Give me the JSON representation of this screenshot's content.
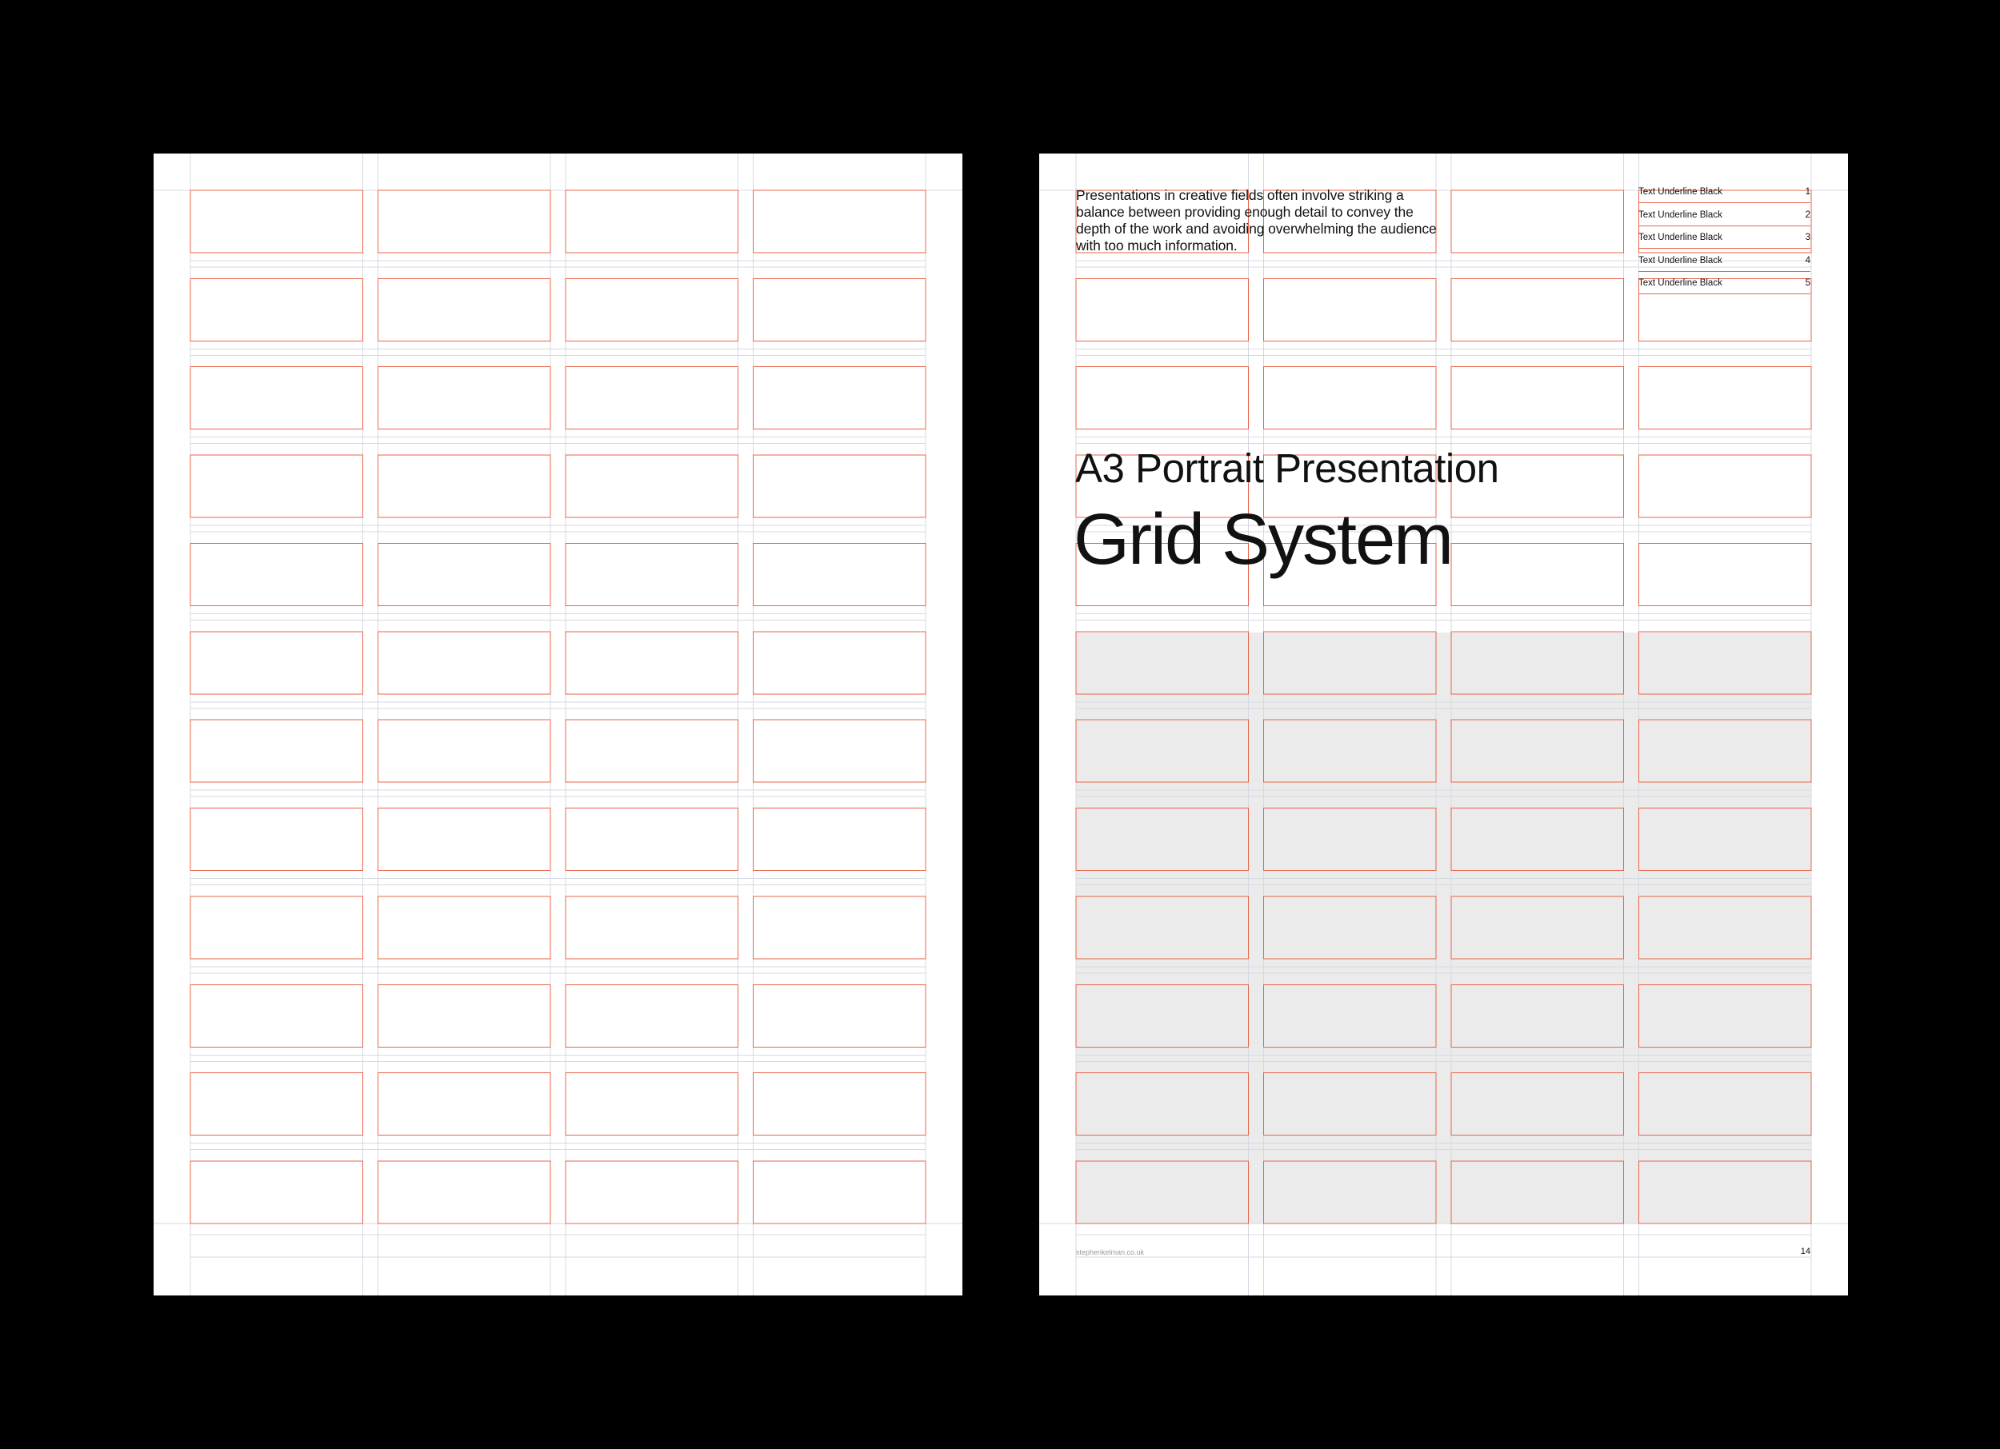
{
  "colors": {
    "background": "#000000",
    "page": "#ffffff",
    "grid_line": "#e8644a",
    "baseline": "#d4d9e2",
    "shaded_area": "#ebebeb",
    "text": "#111111"
  },
  "right_page": {
    "intro": "Presentations in creative fields often involve striking a balance between providing enough detail to convey the depth of the work and avoiding overwhelming the audience with too much information.",
    "subtitle": "A3 Portrait Presentation",
    "title": "Grid System",
    "toc": [
      {
        "label": "Text Underline Black",
        "number": "1"
      },
      {
        "label": "Text Underline Black",
        "number": "2"
      },
      {
        "label": "Text Underline Black",
        "number": "3"
      },
      {
        "label": "Text Underline Black",
        "number": "4"
      },
      {
        "label": "Text Underline Black",
        "number": "5"
      }
    ],
    "footer_url": "stephenkelman.co.uk",
    "page_number": "14"
  }
}
